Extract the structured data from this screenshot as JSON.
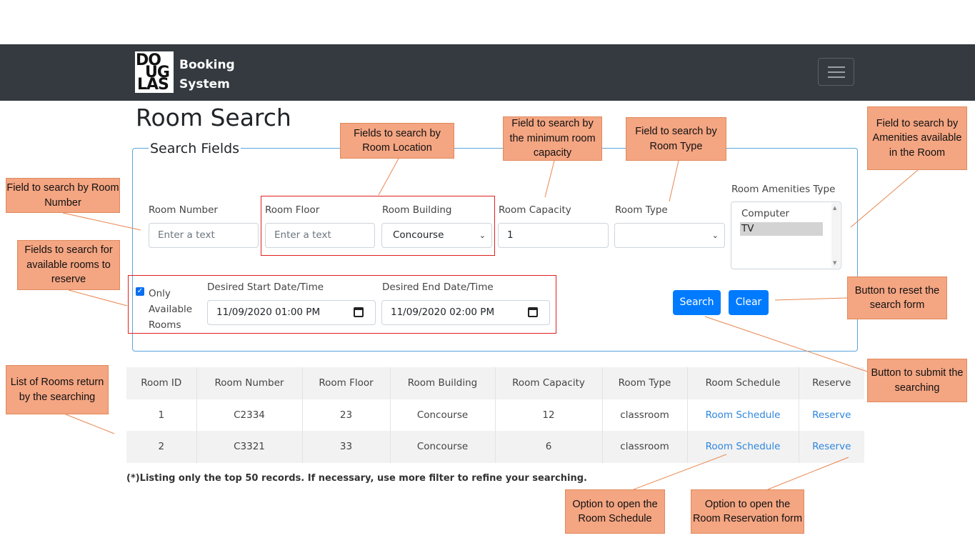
{
  "app": {
    "brand_line1": "Booking",
    "brand_line2": "System",
    "logo_text": [
      "DO",
      "UG",
      "LAS"
    ]
  },
  "page": {
    "title": "Room Search",
    "fieldset_legend": "Search Fields"
  },
  "form": {
    "room_number": {
      "label": "Room Number",
      "placeholder": "Enter a text"
    },
    "room_floor": {
      "label": "Room Floor",
      "placeholder": "Enter a text"
    },
    "room_building": {
      "label": "Room Building",
      "value": "Concourse"
    },
    "room_capacity": {
      "label": "Room Capacity",
      "value": "1"
    },
    "room_type": {
      "label": "Room Type",
      "value": ""
    },
    "amenities": {
      "label": "Room Amenities Type",
      "options": [
        "Computer",
        "TV"
      ],
      "selected": "TV"
    },
    "only_available": {
      "label_line1": "Only",
      "label_line2": "Available",
      "label_line3": "Rooms",
      "checked": true
    },
    "start": {
      "label": "Desired Start Date/Time",
      "value": "11/09/2020 01:00  PM"
    },
    "end": {
      "label": "Desired End Date/Time",
      "value": "11/09/2020 02:00  PM"
    },
    "search_label": "Search",
    "clear_label": "Clear"
  },
  "table": {
    "headers": [
      "Room ID",
      "Room Number",
      "Room Floor",
      "Room Building",
      "Room Capacity",
      "Room Type",
      "Room Schedule",
      "Reserve"
    ],
    "rows": [
      [
        "1",
        "C2334",
        "23",
        "Concourse",
        "12",
        "classroom",
        "Room Schedule",
        "Reserve"
      ],
      [
        "2",
        "C3321",
        "33",
        "Concourse",
        "6",
        "classroom",
        "Room Schedule",
        "Reserve"
      ]
    ]
  },
  "note": "(*)Listing only the top 50 records. If necessary, use more filter to refine your searching.",
  "callouts": {
    "room_number": "Field to search by Room Number",
    "available": "Fields to search for available rooms to reserve",
    "location": "Fields to search by Room Location",
    "capacity": "Field to search by the minimum room capacity",
    "type": "Field to search by Room Type",
    "amenities": "Field to search by Amenities available in the Room",
    "reset": "Button to reset the search form",
    "submit": "Button to submit the searching",
    "list": "List of Rooms return by the searching",
    "schedule": "Option to open the Room Schedule",
    "reservation": "Option to open the Room Reservation form"
  },
  "colors": {
    "navbar": "#343a40",
    "primary": "#007bff",
    "callout": "#f4a582",
    "highlight_box": "#e02020",
    "link": "#2e86de"
  }
}
